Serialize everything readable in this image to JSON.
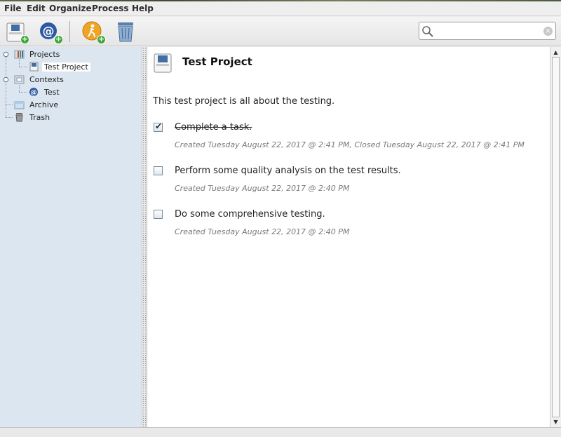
{
  "menu": [
    {
      "label": "File"
    },
    {
      "label": "Edit"
    },
    {
      "label": "Organize"
    },
    {
      "label": "Process"
    },
    {
      "label": "Help"
    }
  ],
  "toolbar": {
    "buttons": [
      {
        "name": "add-project-button",
        "icon": "project-add-icon"
      },
      {
        "name": "add-context-button",
        "icon": "context-add-icon"
      },
      {
        "name": "add-action-button",
        "icon": "action-add-icon"
      },
      {
        "name": "trash-button",
        "icon": "trash-can-icon"
      }
    ]
  },
  "search": {
    "value": "",
    "placeholder": ""
  },
  "sidebar": {
    "projects_label": "Projects",
    "project_item": "Test Project",
    "contexts_label": "Contexts",
    "context_item": "Test",
    "archive_label": "Archive",
    "trash_label": "Trash"
  },
  "main": {
    "title": "Test Project",
    "description": "This test project is all about the testing.",
    "tasks": [
      {
        "text": "Complete a task.",
        "done": true,
        "meta": "Created Tuesday August 22, 2017 @ 2:41 PM, Closed Tuesday August 22, 2017 @ 2:41 PM"
      },
      {
        "text": "Perform some quality analysis on the test results.",
        "done": false,
        "meta": "Created Tuesday August 22, 2017 @ 2:40 PM"
      },
      {
        "text": "Do some comprehensive testing.",
        "done": false,
        "meta": "Created Tuesday August 22, 2017 @ 2:40 PM"
      }
    ]
  },
  "colors": {
    "sidebar_bg": "#dce6f0",
    "accent": "#3b67a8",
    "add_badge": "#3da83a"
  }
}
